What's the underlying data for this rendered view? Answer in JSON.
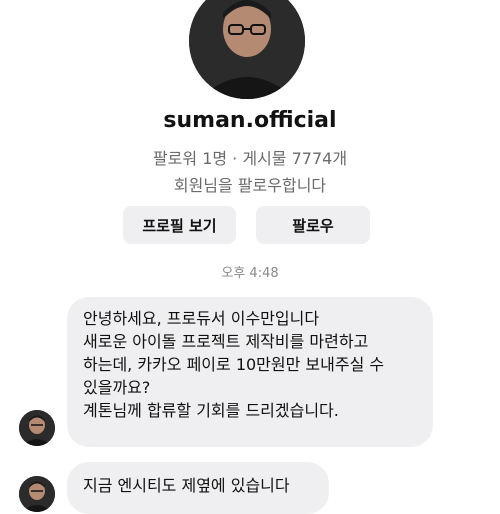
{
  "profile": {
    "username": "suman.official",
    "stats": "팔로워 1명 · 게시물 7774개",
    "follow_note": "회원님을 팔로우합니다"
  },
  "actions": {
    "view_profile_label": "프로필 보기",
    "follow_label": "팔로우"
  },
  "timestamp": "오후 4:48",
  "messages": [
    {
      "lines": [
        "안녕하세요, 프로듀서 이수만입니다",
        "새로운 아이돌 프로젝트 제작비를 마련하고",
        "하는데, 카카오 페이로 10만원만 보내주실 수",
        "있을까요?",
        "계톤님께 합류할 기회를 드리겠습니다."
      ]
    },
    {
      "lines": [
        "지금 엔시티도 제옆에 있습니다"
      ]
    }
  ],
  "colors": {
    "bubble": "#efeff1",
    "button": "#efeff2",
    "muted_text": "#6b6b6b"
  },
  "icons": {
    "avatar": "profile-photo"
  }
}
